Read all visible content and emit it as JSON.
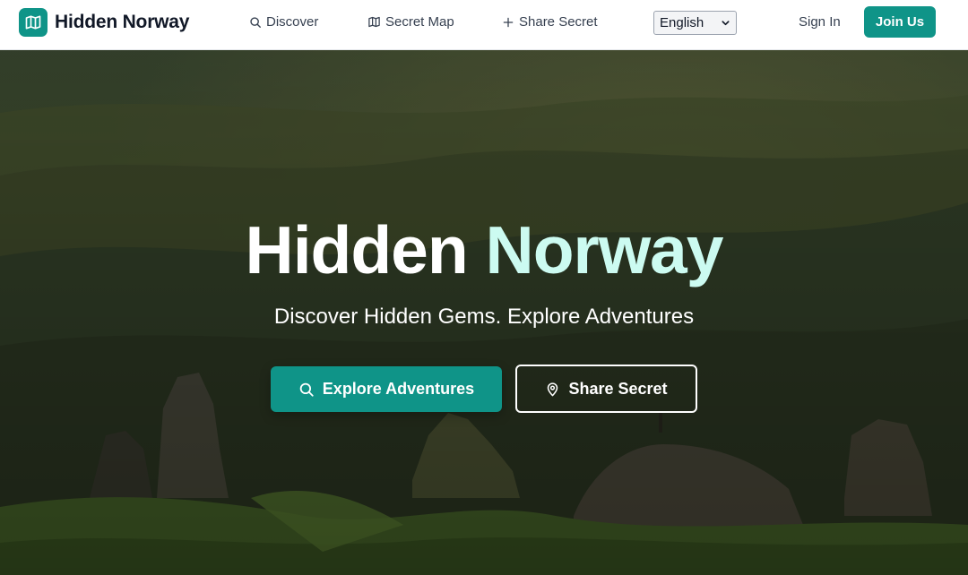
{
  "brand": {
    "name": "Hidden Norway",
    "logo_icon": "map-icon",
    "color": "#0f9488"
  },
  "nav": {
    "items": [
      {
        "label": "Discover",
        "icon": "search-icon"
      },
      {
        "label": "Secret Map",
        "icon": "map-icon"
      },
      {
        "label": "Share Secret",
        "icon": "plus-icon"
      }
    ],
    "language": {
      "selected": "English"
    },
    "sign_in": "Sign In",
    "join": "Join Us"
  },
  "hero": {
    "title_part1": "Hidden",
    "title_part2": "Norway",
    "subtitle": "Discover Hidden Gems. Explore Adventures",
    "primary_button": {
      "label": "Explore Adventures",
      "icon": "search-icon"
    },
    "secondary_button": {
      "label": "Share Secret",
      "icon": "map-pin-icon"
    },
    "accent_text_color": "#ccfbf1"
  }
}
